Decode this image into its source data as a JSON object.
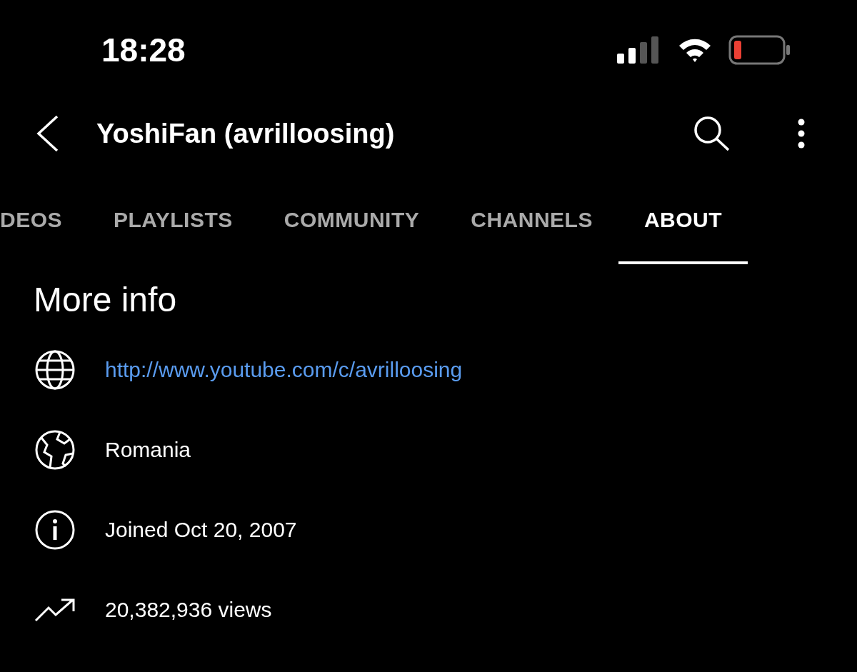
{
  "status_bar": {
    "time": "18:28"
  },
  "header": {
    "title": "YoshiFan (avrilloosing)"
  },
  "tabs": [
    {
      "label": "DEOS",
      "selected": false
    },
    {
      "label": "PLAYLISTS",
      "selected": false
    },
    {
      "label": "COMMUNITY",
      "selected": false
    },
    {
      "label": "CHANNELS",
      "selected": false
    },
    {
      "label": "ABOUT",
      "selected": true
    }
  ],
  "about": {
    "heading": "More info",
    "items": [
      {
        "kind": "link",
        "text": "http://www.youtube.com/c/avrilloosing"
      },
      {
        "kind": "location",
        "text": "Romania"
      },
      {
        "kind": "joined",
        "text": "Joined Oct 20, 2007"
      },
      {
        "kind": "views",
        "text": "20,382,936 views"
      }
    ]
  }
}
